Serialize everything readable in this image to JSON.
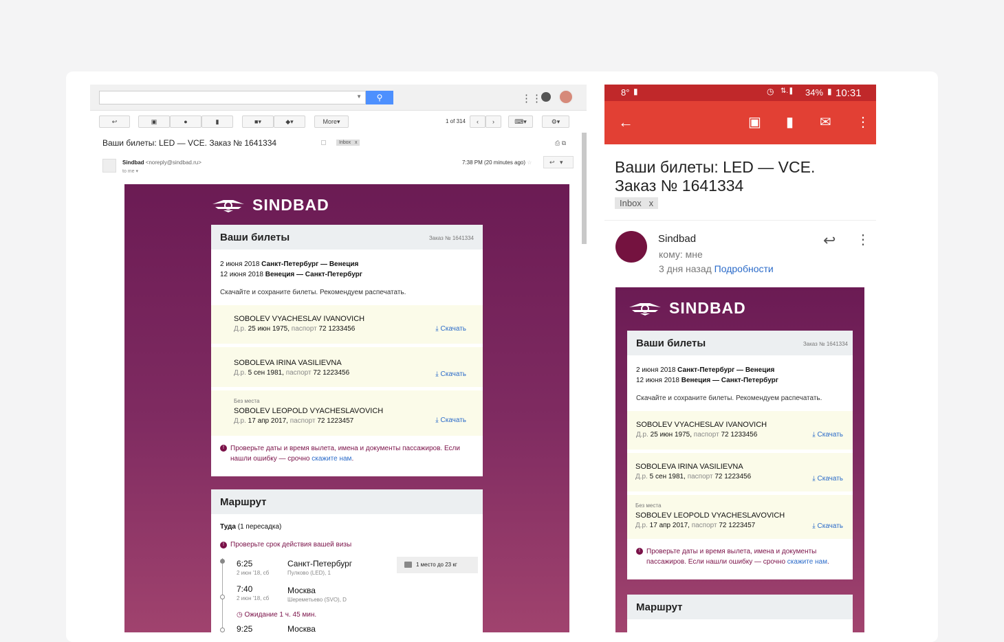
{
  "gmail": {
    "page_counter": "1 of 314",
    "more_label": "More",
    "subject": "Ваши билеты: LED — VCE. Заказ № 1641334",
    "label_tag": "Inbox",
    "label_close": "x",
    "sender_name": "Sindbad",
    "sender_email": "<noreply@sindbad.ru>",
    "to_me": "to me",
    "time": "7:38 PM (20 minutes ago)"
  },
  "email": {
    "brand": "SINDBAD",
    "tickets_title": "Ваши билеты",
    "order": "Заказ № 1641334",
    "route_lines": [
      {
        "date": "2 июня 2018",
        "route": "Санкт-Петербург — Венеция"
      },
      {
        "date": "12 июня 2018",
        "route": "Венеция — Санкт-Петербург"
      }
    ],
    "download_note": "Скачайте и сохраните билеты. Рекомендуем распечатать.",
    "passengers": [
      {
        "note": "",
        "name": "SOBOLEV VYACHESLAV IVANOVICH",
        "dob_label": "Д.р.",
        "dob": "25 июн 1975",
        "passport_label": "паспорт",
        "passport": "72 1233456",
        "download": "Скачать"
      },
      {
        "note": "",
        "name": "SOBOLEVA IRINA VASILIEVNA",
        "dob_label": "Д.р.",
        "dob": "5 сен 1981",
        "passport_label": "паспорт",
        "passport": "72 1223456",
        "download": "Скачать"
      },
      {
        "note": "Без места",
        "name": "SOBOLEV LEOPOLD VYACHESLAVOVICH",
        "dob_label": "Д.р.",
        "dob": "17 апр 2017",
        "passport_label": "паспорт",
        "passport": "72 1223457",
        "download": "Скачать"
      }
    ],
    "warning_text": "Проверьте даты и время вылета, имена и документы пассажиров. Если нашли ошибку — срочно",
    "warning_link": "скажите нам",
    "route_title": "Маршрут",
    "direction_label": "Туда",
    "direction_note": "(1 пересадка)",
    "visa_warning": "Проверьте срок действия вашей визы",
    "segments": [
      {
        "time": "6:25",
        "date": "2 июн '18, сб",
        "city": "Санкт-Петербург",
        "airport": "Пулково (LED), 1"
      },
      {
        "time": "7:40",
        "date": "2 июн '18, сб",
        "city": "Москва",
        "airport": "Шереметьево (SVO), D"
      },
      {
        "time": "9:25",
        "date": "",
        "city": "Москва",
        "airport": ""
      }
    ],
    "baggage": "1 место до 23 кг",
    "layover": "Ожидание 1 ч. 45 мин."
  },
  "android": {
    "status_temp": "8°",
    "status_battery": "34%",
    "status_time": "10:31",
    "subject_line1": "Ваши билеты: LED — VCE.",
    "subject_line2": "Заказ № 1641334",
    "label_tag": "Inbox",
    "label_close": "x",
    "sender": "Sindbad",
    "to": "кому: мне",
    "ago": "3 дня назад",
    "details_link": "Подробности"
  },
  "colors": {
    "brand": "#74123f",
    "android_bar": "#e24034",
    "link": "#2b6bc9"
  }
}
